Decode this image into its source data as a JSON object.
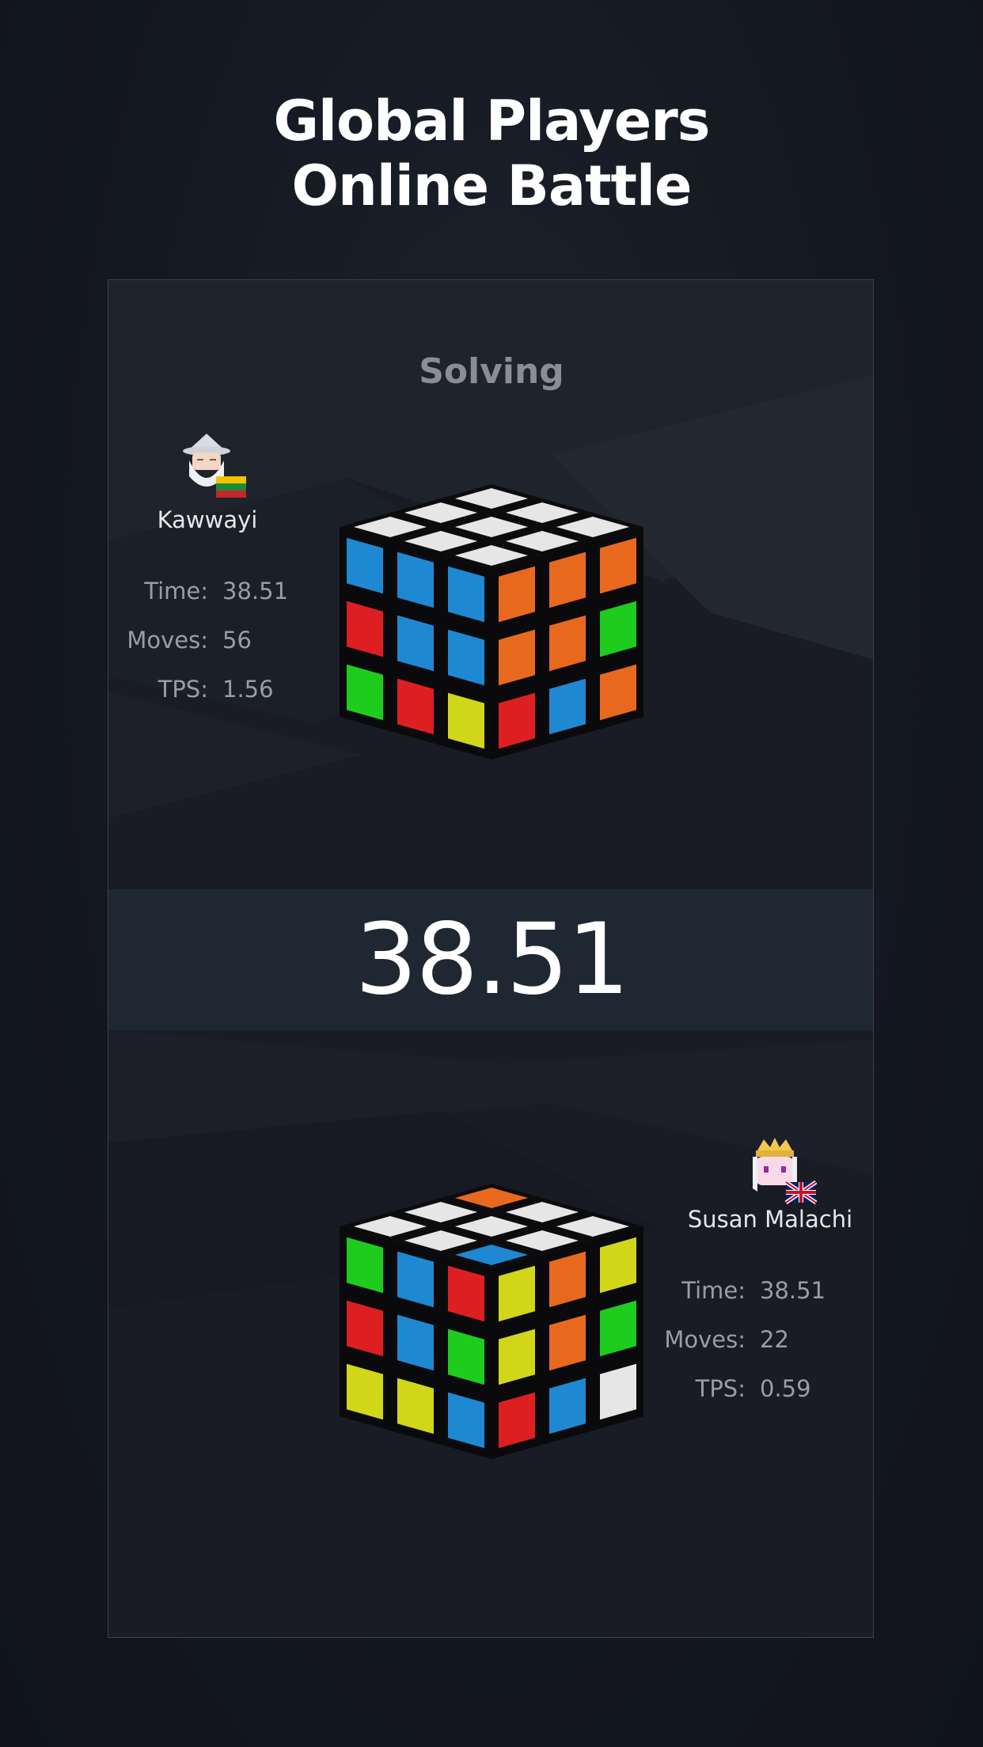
{
  "headline": {
    "line1": "Global Players",
    "line2": "Online Battle"
  },
  "status": "Solving",
  "timer": "38.51",
  "player1": {
    "name": "Kawwayi",
    "flag": "lithuania-flag",
    "avatar": "wizard-avatar",
    "time_label": "Time:",
    "time": "38.51",
    "moves_label": "Moves:",
    "moves": "56",
    "tps_label": "TPS:",
    "tps": "1.56"
  },
  "player2": {
    "name": "Susan Malachi",
    "flag": "united-kingdom-flag",
    "avatar": "princess-avatar",
    "time_label": "Time:",
    "time": "38.51",
    "moves_label": "Moves:",
    "moves": "22",
    "tps_label": "TPS:",
    "tps": "0.59"
  },
  "colors": {
    "white": "#e6e6e6",
    "blue": "#1e88d2",
    "orange": "#e8691e",
    "red": "#dd1f22",
    "green": "#1ecc1e",
    "yellow": "#d2d619",
    "background": "#141821"
  },
  "cube1": {
    "top": [
      "white",
      "white",
      "white",
      "white",
      "white",
      "white",
      "white",
      "white",
      "white"
    ],
    "left": [
      "blue",
      "blue",
      "blue",
      "red",
      "blue",
      "blue",
      "green",
      "red",
      "yellow"
    ],
    "right": [
      "orange",
      "orange",
      "orange",
      "orange",
      "orange",
      "green",
      "red",
      "blue",
      "orange"
    ]
  },
  "cube2": {
    "top": [
      "orange",
      "white",
      "white",
      "white",
      "white",
      "white",
      "white",
      "white",
      "blue"
    ],
    "left": [
      "green",
      "blue",
      "red",
      "red",
      "blue",
      "green",
      "yellow",
      "yellow",
      "blue"
    ],
    "right": [
      "yellow",
      "orange",
      "yellow",
      "yellow",
      "orange",
      "green",
      "red",
      "blue",
      "white"
    ]
  }
}
